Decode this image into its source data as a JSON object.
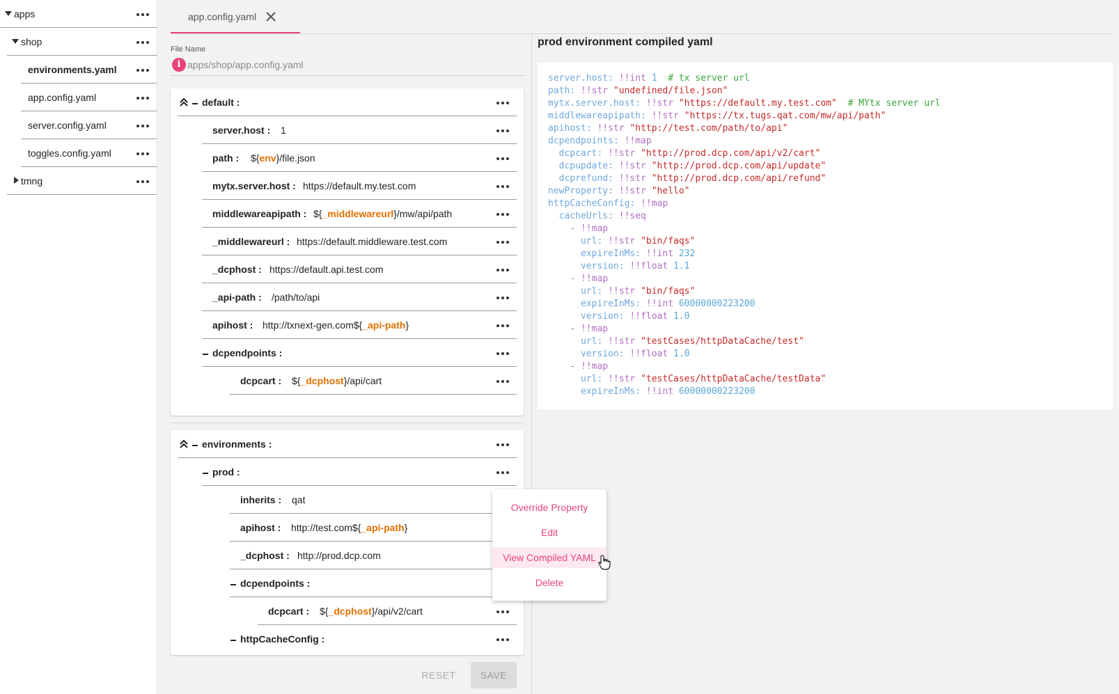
{
  "sidebar": {
    "items": [
      {
        "label": "apps"
      },
      {
        "label": "shop"
      },
      {
        "label": "environments.yaml"
      },
      {
        "label": "app.config.yaml"
      },
      {
        "label": "server.config.yaml"
      },
      {
        "label": "toggles.config.yaml"
      },
      {
        "label": "tmng"
      }
    ]
  },
  "tab": {
    "label": "app.config.yaml"
  },
  "file_name": {
    "caption": "File Name",
    "value": "apps/shop/app.config.yaml",
    "info_icon_glyph": "i"
  },
  "default_card": {
    "title": "default :",
    "rows": [
      {
        "key": "server.host :",
        "value": "1"
      },
      {
        "key": "path :",
        "pre": "${",
        "ref": "env",
        "post": "}/file.json"
      },
      {
        "key": "mytx.server.host :",
        "value": "https://default.my.test.com"
      },
      {
        "key": "middlewareapipath :",
        "pre": "${",
        "ref": "_middlewareurl",
        "post": "}/mw/api/path"
      },
      {
        "key": "_middlewareurl :",
        "value": "https://default.middleware.test.com"
      },
      {
        "key": "_dcphost :",
        "value": "https://default.api.test.com"
      },
      {
        "key": "_api-path :",
        "value": "/path/to/api"
      },
      {
        "key": "apihost :",
        "pre": "http://txnext-gen.com${",
        "ref": "_api-path",
        "post": "}"
      },
      {
        "key": "dcpendpoints :"
      },
      {
        "key": "dcpcart :",
        "pre": "${",
        "ref": "_dcphost",
        "post": "}/api/cart"
      }
    ]
  },
  "env_card": {
    "title": "environments :",
    "rows": [
      {
        "key": "prod :"
      },
      {
        "key": "inherits :",
        "value": "qat"
      },
      {
        "key": "apihost :",
        "pre": "http://test.com${",
        "ref": "_api-path",
        "post": "}"
      },
      {
        "key": "_dcphost :",
        "value": "http://prod.dcp.com"
      },
      {
        "key": "dcpendpoints :"
      },
      {
        "key": "dcpcart :",
        "pre": "${",
        "ref": "_dcphost",
        "post": "}/api/v2/cart"
      },
      {
        "key": "httpCacheConfig :"
      }
    ]
  },
  "buttons": {
    "reset": "RESET",
    "save": "SAVE"
  },
  "compiled": {
    "title": "prod environment compiled yaml",
    "lines": [
      [
        [
          "k",
          "server.host: "
        ],
        [
          "t",
          "!!int "
        ],
        [
          "n",
          "1"
        ],
        [
          "c",
          "  # tx server url"
        ]
      ],
      [
        [
          "k",
          "path: "
        ],
        [
          "t",
          "!!str "
        ],
        [
          "s",
          "\"undefined/file.json\""
        ]
      ],
      [
        [
          "k",
          "mytx.server.host: "
        ],
        [
          "t",
          "!!str "
        ],
        [
          "s",
          "\"https://default.my.test.com\""
        ],
        [
          "c",
          "  # MYtx server url"
        ]
      ],
      [
        [
          "k",
          "middlewareapipath: "
        ],
        [
          "t",
          "!!str "
        ],
        [
          "s",
          "\"https://tx.tugs.qat.com/mw/api/path\""
        ]
      ],
      [
        [
          "k",
          "apihost: "
        ],
        [
          "t",
          "!!str "
        ],
        [
          "s",
          "\"http://test.com/path/to/api\""
        ]
      ],
      [
        [
          "k",
          "dcpendpoints: "
        ],
        [
          "t",
          "!!map"
        ]
      ],
      [
        [
          "k",
          "  dcpcart: "
        ],
        [
          "t",
          "!!str "
        ],
        [
          "s",
          "\"http://prod.dcp.com/api/v2/cart\""
        ]
      ],
      [
        [
          "k",
          "  dcpupdate: "
        ],
        [
          "t",
          "!!str "
        ],
        [
          "s",
          "\"http://prod.dcp.com/api/update\""
        ]
      ],
      [
        [
          "k",
          "  dcprefund: "
        ],
        [
          "t",
          "!!str "
        ],
        [
          "s",
          "\"http://prod.dcp.com/api/refund\""
        ]
      ],
      [
        [
          "k",
          "newProperty: "
        ],
        [
          "t",
          "!!str "
        ],
        [
          "s",
          "\"hello\""
        ]
      ],
      [
        [
          "k",
          "httpCacheConfig: "
        ],
        [
          "t",
          "!!map"
        ]
      ],
      [
        [
          "k",
          "  cacheUrls: "
        ],
        [
          "t",
          "!!seq"
        ]
      ],
      [
        [
          "t",
          "    - !!map"
        ]
      ],
      [
        [
          "k",
          "      url: "
        ],
        [
          "t",
          "!!str "
        ],
        [
          "s",
          "\"bin/faqs\""
        ]
      ],
      [
        [
          "k",
          "      expireInMs: "
        ],
        [
          "t",
          "!!int "
        ],
        [
          "n",
          "232"
        ]
      ],
      [
        [
          "k",
          "      version: "
        ],
        [
          "t",
          "!!float "
        ],
        [
          "n",
          "1.1"
        ]
      ],
      [
        [
          "t",
          "    - !!map"
        ]
      ],
      [
        [
          "k",
          "      url: "
        ],
        [
          "t",
          "!!str "
        ],
        [
          "s",
          "\"bin/faqs\""
        ]
      ],
      [
        [
          "k",
          "      expireInMs: "
        ],
        [
          "t",
          "!!int "
        ],
        [
          "n",
          "60000000223200"
        ]
      ],
      [
        [
          "k",
          "      version: "
        ],
        [
          "t",
          "!!float "
        ],
        [
          "n",
          "1.0"
        ]
      ],
      [
        [
          "t",
          "    - !!map"
        ]
      ],
      [
        [
          "k",
          "      url: "
        ],
        [
          "t",
          "!!str "
        ],
        [
          "s",
          "\"testCases/httpDataCache/test\""
        ]
      ],
      [
        [
          "k",
          "      version: "
        ],
        [
          "t",
          "!!float "
        ],
        [
          "n",
          "1.0"
        ]
      ],
      [
        [
          "t",
          "    - !!map"
        ]
      ],
      [
        [
          "k",
          "      url: "
        ],
        [
          "t",
          "!!str "
        ],
        [
          "s",
          "\"testCases/httpDataCache/testData\""
        ]
      ],
      [
        [
          "k",
          "      expireInMs: "
        ],
        [
          "t",
          "!!int "
        ],
        [
          "n",
          "60000000223200"
        ]
      ]
    ]
  },
  "context_menu": {
    "items": [
      "Override Property",
      "Edit",
      "View Compiled YAML",
      "Delete"
    ],
    "highlighted": "View Compiled YAML"
  },
  "colors": {
    "accent": "#e8447a",
    "reference": "#e07000"
  }
}
